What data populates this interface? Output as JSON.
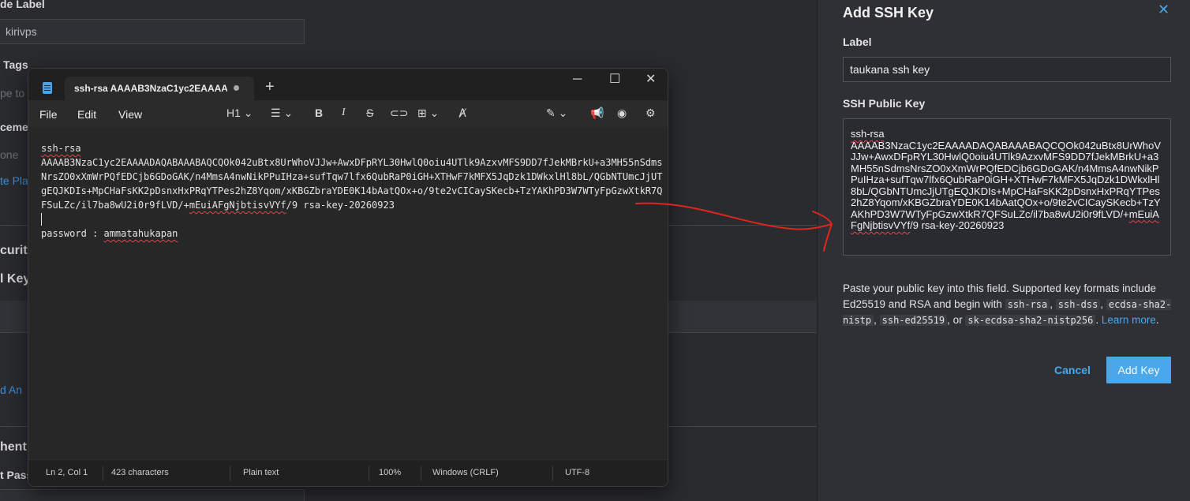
{
  "background": {
    "node_label_heading": "de Label",
    "node_label_value": "kirivps",
    "tags_heading": "Tags",
    "tags_placeholder": "pe to",
    "placement_heading": "ceme",
    "placement_value": "one",
    "placement_link": "te Pla",
    "security_heading": "curit",
    "ssh_keys_heading": "l Key",
    "add_link": "d An",
    "auth_heading": "hent",
    "password_label": "t Pass"
  },
  "notepad": {
    "tab_title": "ssh-rsa AAAAB3NzaC1yc2EAAAAD",
    "menu": [
      "File",
      "Edit",
      "View"
    ],
    "heading_selector": "H1",
    "content": {
      "line1": "ssh-rsa",
      "line2_key": "AAAAB3NzaC1yc2EAAAADAQABAAABAQCQOk042uBtx8UrWhoVJJw+AwxDFpRYL30HwlQ0oiu4UTlk9AzxvMFS9DD7fJekMBrkU+a3MH55nSdmsNrsZO0xXmWrPQfEDCjb6GDoGAK/n4MmsA4nwNikPPuIHza+sufTqw7lfx6QubRaP0iGH+XTHwF7kMFX5JqDzk1DWkxlHl8bL/QGbNTUmcJjUTgEQJKDIs+MpCHaFsKK2pDsnxHxPRqYTPes2hZ8Yqom/xKBGZbraYDE0K14bAatQOx+o/9te2vCICaySKecb+TzYAKhPD3W7WTyFpGzwXtkR7QFSuLZc/il7ba8wU2i0r9fLVD/+",
      "line2_squiggle": "mEuiAFgNjbtisvVYf",
      "line2_tail": "/9 rsa-key-20260923",
      "password_prefix": "password : ",
      "password_value": "ammatahukapan"
    },
    "status": {
      "position": "Ln 2, Col 1",
      "characters": "423 characters",
      "format": "Plain text",
      "zoom": "100%",
      "line_endings": "Windows (CRLF)",
      "encoding": "UTF-8"
    }
  },
  "panel": {
    "title": "Add SSH Key",
    "label_heading": "Label",
    "label_value": "taukana ssh key",
    "key_heading": "SSH Public Key",
    "key_prefix": "ssh-rsa",
    "key_body": "AAAAB3NzaC1yc2EAAAADAQABAAABAQCQOk042uBtx8UrWhoVJJw+AwxDFpRYL30HwlQ0oiu4UTlk9AzxvMFS9DD7fJekMBrkU+a3MH55nSdmsNrsZO0xXmWrPQfEDCjb6GDoGAK/n4MmsA4nwNikPPuIHza+sufTqw7lfx6QubRaP0iGH+XTHwF7kMFX5JqDzk1DWkxlHl8bL/QGbNTUmcJjUTgEQJKDIs+MpCHaFsKK2pDsnxHxPRqYTPes2hZ8Yqom/xKBGZbraYDE0K14bAatQOx+o/9te2vCICaySKecb+TzYAKhPD3W7WTyFpGzwXtkR7QFSuLZc/il7ba8wU2i0r9fLVD/+",
    "key_squiggle": "mEuiAFgNjbtisvVYf",
    "key_tail": "/9 rsa-key-20260923",
    "help": {
      "text1": "Paste your public key into this field. Supported key formats include Ed25519 and RSA and begin with",
      "fmt1": "ssh-rsa",
      "fmt2": "ssh-dss",
      "fmt3": "ecdsa-sha2-nistp",
      "fmt4": "ssh-ed25519",
      "or": ", or",
      "fmt5": "sk-ecdsa-sha2-nistp256",
      "link": "Learn more"
    },
    "cancel_label": "Cancel",
    "add_label": "Add Key",
    "accent_color": "#4aa8ea"
  }
}
